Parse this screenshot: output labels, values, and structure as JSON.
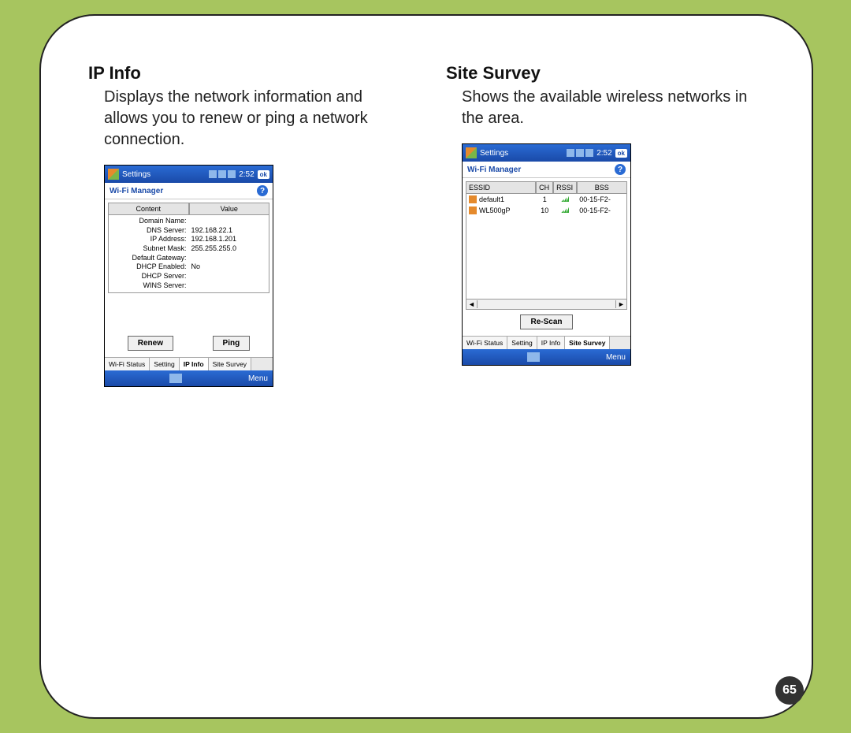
{
  "page_number": "65",
  "left": {
    "title": "IP Info",
    "desc": "Displays the network information and allows you to renew or ping a network connection.",
    "device": {
      "titlebar_label": "Settings",
      "titlebar_time": "2:52",
      "titlebar_ok": "ok",
      "subheader": "Wi-Fi Manager",
      "col_content": "Content",
      "col_value": "Value",
      "rows": [
        {
          "k": "Domain Name:",
          "v": ""
        },
        {
          "k": "DNS Server:",
          "v": "192.168.22.1"
        },
        {
          "k": "IP Address:",
          "v": "192.168.1.201"
        },
        {
          "k": "Subnet Mask:",
          "v": "255.255.255.0"
        },
        {
          "k": "Default Gateway:",
          "v": ""
        },
        {
          "k": "DHCP Enabled:",
          "v": "No"
        },
        {
          "k": "DHCP Server:",
          "v": ""
        },
        {
          "k": "WINS Server:",
          "v": ""
        }
      ],
      "btn_renew": "Renew",
      "btn_ping": "Ping",
      "tabs": [
        "Wi-Fi Status",
        "Setting",
        "IP Info",
        "Site Survey"
      ],
      "active_tab": "IP Info",
      "menu_label": "Menu"
    }
  },
  "right": {
    "title": "Site Survey",
    "desc": "Shows the available wireless networks in the area.",
    "device": {
      "titlebar_label": "Settings",
      "titlebar_time": "2:52",
      "titlebar_ok": "ok",
      "subheader": "Wi-Fi Manager",
      "cols": {
        "essid": "ESSID",
        "ch": "CH",
        "rssi": "RSSI",
        "bss": "BSS"
      },
      "rows": [
        {
          "essid": "default1",
          "ch": "1",
          "bss": "00-15-F2-"
        },
        {
          "essid": "WL500gP",
          "ch": "10",
          "bss": "00-15-F2-"
        }
      ],
      "btn_rescan": "Re-Scan",
      "tabs": [
        "Wi-Fi Status",
        "Setting",
        "IP Info",
        "Site Survey"
      ],
      "active_tab": "Site Survey",
      "menu_label": "Menu"
    }
  }
}
